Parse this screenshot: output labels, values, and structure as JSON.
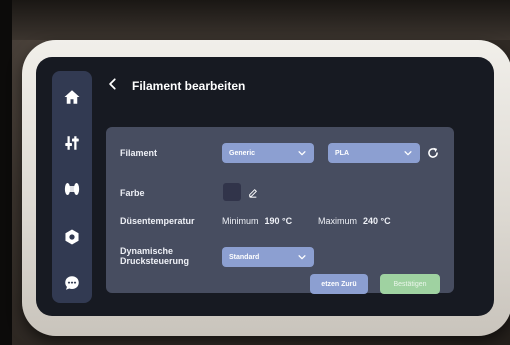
{
  "sidebar": {
    "items": [
      {
        "icon": "home-icon"
      },
      {
        "icon": "sliders-icon"
      },
      {
        "icon": "filament-spool-icon"
      },
      {
        "icon": "settings-icon"
      },
      {
        "icon": "chat-icon"
      }
    ]
  },
  "header": {
    "back_icon": "chevron-left-icon",
    "title": "Filament bearbeiten"
  },
  "form": {
    "filament_label": "Filament",
    "filament_brand": "Generic",
    "filament_type": "PLA",
    "color_label": "Farbe",
    "color_value": "#31344a",
    "nozzle_temp_label": "Düsentemperatur",
    "min_label": "Minimum",
    "min_value": "190 °C",
    "max_label": "Maximum",
    "max_value": "240 °C",
    "pressure_label_line1": "Dynamische",
    "pressure_label_line2": "Drucksteuerung",
    "pressure_value": "Standard"
  },
  "buttons": {
    "reset_label": "etzen Zurü",
    "confirm_label": "Bestätigen"
  }
}
